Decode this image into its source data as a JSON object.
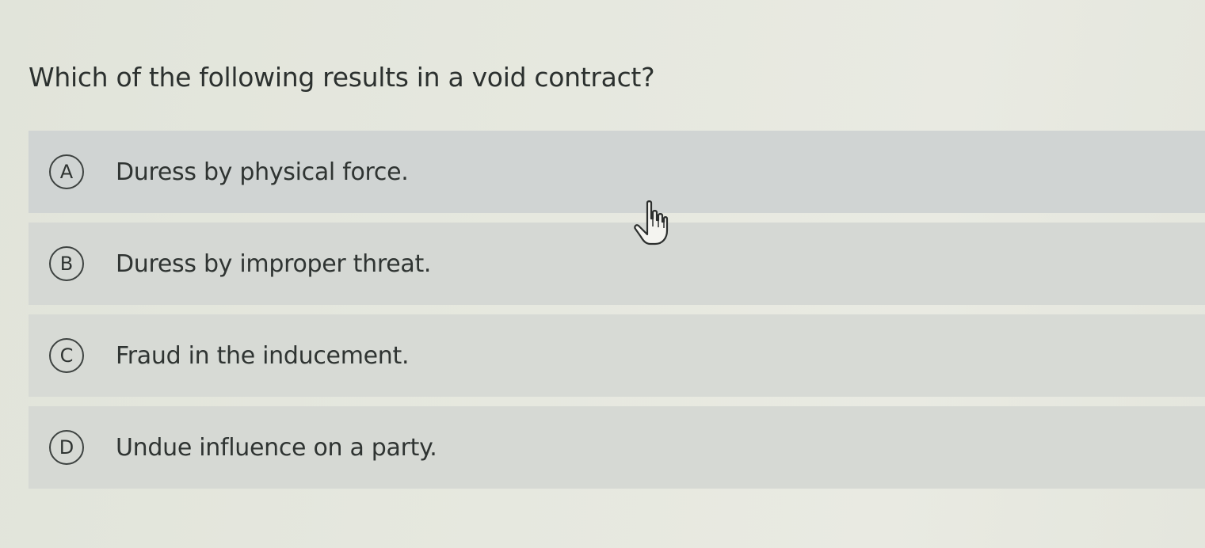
{
  "question": {
    "text": "Which of the following results in a void contract?"
  },
  "options": [
    {
      "letter": "A",
      "text": "Duress by physical force."
    },
    {
      "letter": "B",
      "text": "Duress by improper threat."
    },
    {
      "letter": "C",
      "text": "Fraud in the inducement."
    },
    {
      "letter": "D",
      "text": "Undue influence on a party."
    }
  ],
  "cursor": {
    "icon": "hand-pointer-icon"
  },
  "colors": {
    "page_background": "#e3e6de",
    "option_background": "#d4d8d4",
    "text": "#2f3432"
  }
}
